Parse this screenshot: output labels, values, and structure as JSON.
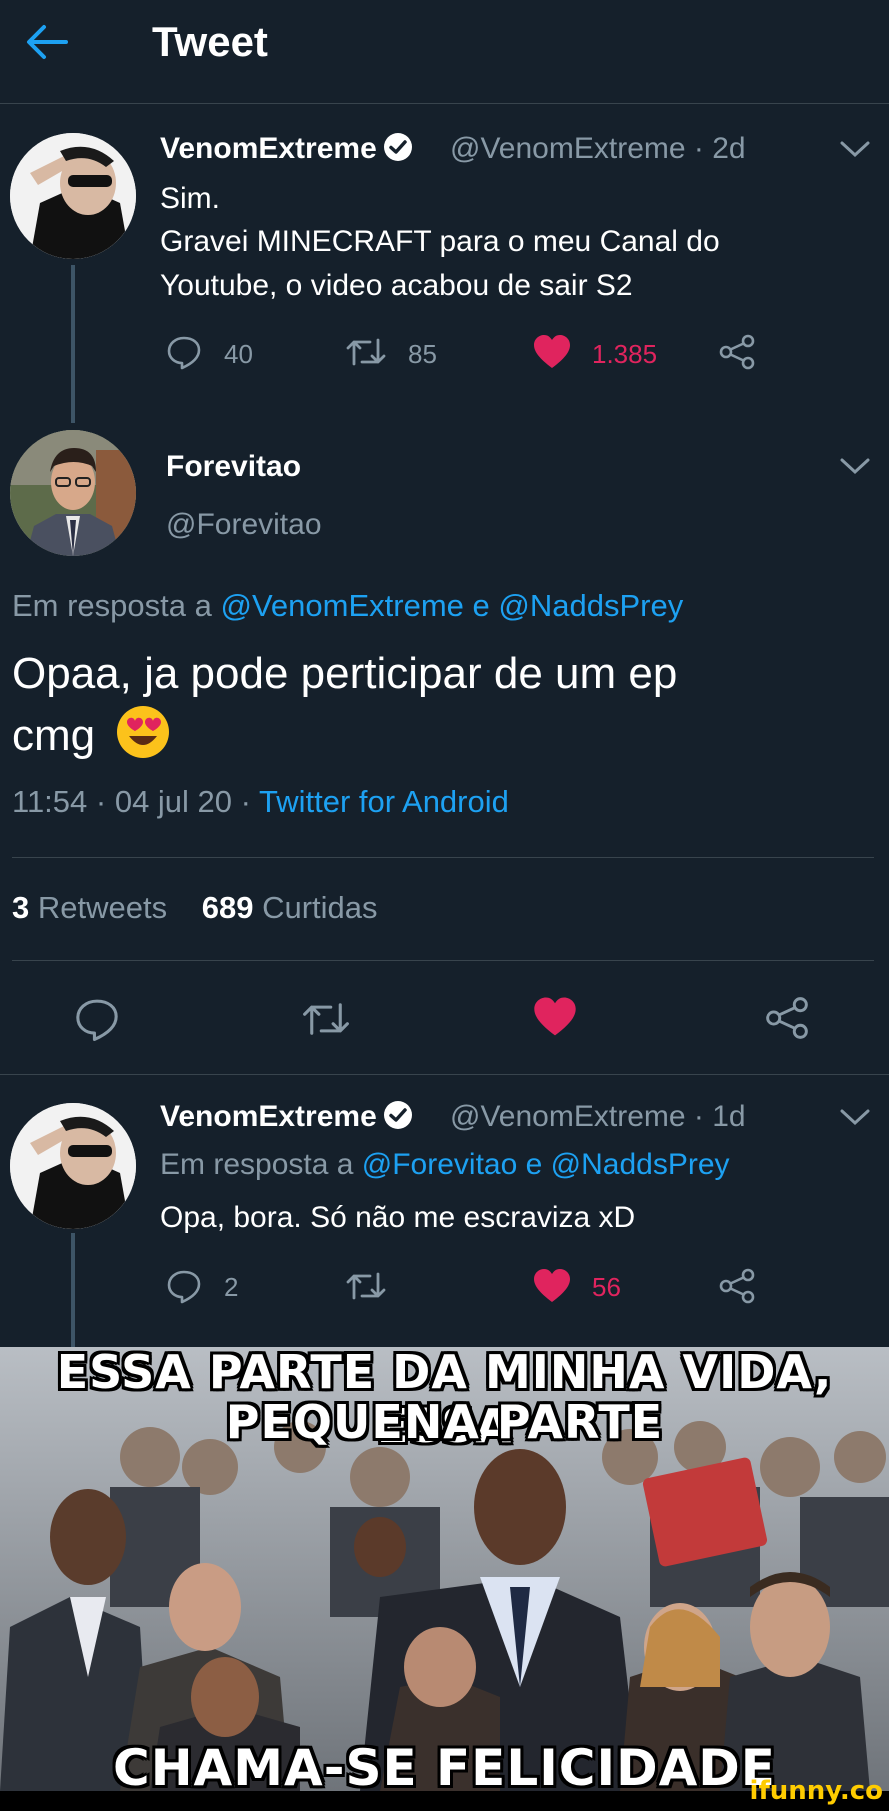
{
  "header": {
    "title": "Tweet"
  },
  "tweet1": {
    "name": "VenomExtreme",
    "handle": "@VenomExtreme",
    "time": "· 2d",
    "lines": [
      "Sim.",
      "Gravei MINECRAFT para o meu Canal do",
      "Youtube, o video acabou de sair S2"
    ],
    "replies": "40",
    "retweets": "85",
    "likes": "1.385"
  },
  "main_tweet": {
    "name": "Forevitao",
    "handle": "@Forevitao",
    "reply_prefix": "Em resposta a",
    "reply_user1": "@VenomExtreme",
    "reply_and": "e",
    "reply_user2": "@NaddsPrey",
    "text_line1": "Opaa, ja pode perticipar de um ep",
    "text_line2": "cmg",
    "time": "11:54 · 04 jul 20 ·",
    "source": "Twitter for Android",
    "retweet_count": "3",
    "retweet_label": "Retweets",
    "like_count": "689",
    "like_label": "Curtidas"
  },
  "tweet3": {
    "name": "VenomExtreme",
    "handle": "@VenomExtreme",
    "time": "· 1d",
    "reply_prefix": "Em resposta a",
    "reply_user1": "@Forevitao",
    "reply_and": "e",
    "reply_user2": "@NaddsPrey",
    "text": "Opa, bora. Só não me escraviza xD",
    "replies": "2",
    "likes": "56"
  },
  "meme": {
    "line1": "ESSA PARTE DA MINHA VIDA, ESSA",
    "line2": "PEQUENA PARTE",
    "bottom": "CHAMA-SE FELICIDADE"
  },
  "watermark": "ifunny.co",
  "colors": {
    "background": "#15202b",
    "accent": "#1da1f2",
    "like": "#e0245e",
    "muted": "#8899a6",
    "divider": "#38444d"
  }
}
